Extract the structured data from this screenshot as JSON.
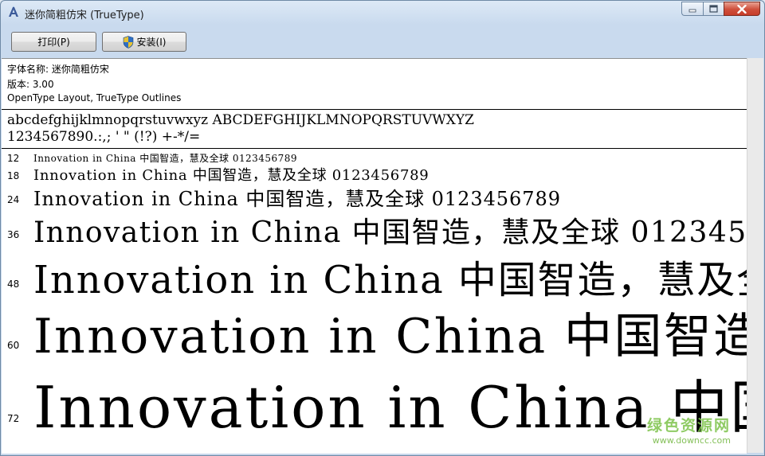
{
  "window": {
    "title": "迷你简粗仿宋 (TrueType)"
  },
  "toolbar": {
    "print_label": "打印(P)",
    "install_label": "安装(I)"
  },
  "info": {
    "font_name": "字体名称: 迷你简粗仿宋",
    "version": "版本: 3.00",
    "outlines": "OpenType Layout, TrueType Outlines"
  },
  "charset": {
    "line1": "abcdefghijklmnopqrstuvwxyz ABCDEFGHIJKLMNOPQRSTUVWXYZ",
    "line2": "1234567890.:,; ' \" (!?) +-*/="
  },
  "samples": {
    "text": "Innovation in China 中国智造，慧及全球 0123456789",
    "rows": [
      {
        "size": "12"
      },
      {
        "size": "18"
      },
      {
        "size": "24"
      },
      {
        "size": "36"
      },
      {
        "size": "48"
      },
      {
        "size": "60"
      },
      {
        "size": "72"
      }
    ]
  },
  "watermark": {
    "line1": "绿色资源网",
    "line2": "www.downcc.com"
  },
  "colors": {
    "titlebar": "#c9daee",
    "close_button": "#c63d2a",
    "watermark": "#7cc24a"
  }
}
